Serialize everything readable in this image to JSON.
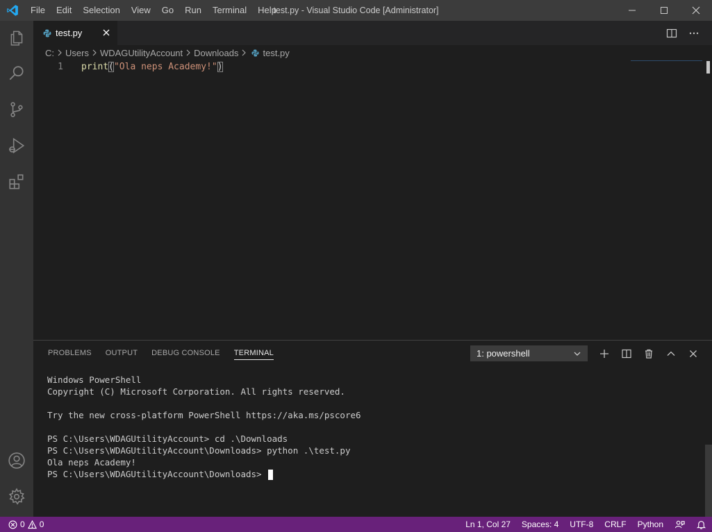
{
  "window": {
    "title": "test.py - Visual Studio Code [Administrator]"
  },
  "menu": [
    "File",
    "Edit",
    "Selection",
    "View",
    "Go",
    "Run",
    "Terminal",
    "Help"
  ],
  "tab": {
    "label": "test.py"
  },
  "breadcrumb": [
    "C:",
    "Users",
    "WDAGUtilityAccount",
    "Downloads",
    "test.py"
  ],
  "editor": {
    "line_number": "1",
    "code": {
      "fn": "print",
      "open": "(",
      "string": "\"Ola neps Academy!\"",
      "close": ")"
    }
  },
  "panel": {
    "tabs": [
      "PROBLEMS",
      "OUTPUT",
      "DEBUG CONSOLE",
      "TERMINAL"
    ],
    "active_tab": "TERMINAL",
    "terminal_select": "1: powershell"
  },
  "terminal": {
    "lines": [
      "Windows PowerShell",
      "Copyright (C) Microsoft Corporation. All rights reserved.",
      "",
      "Try the new cross-platform PowerShell https://aka.ms/pscore6",
      "",
      "PS C:\\Users\\WDAGUtilityAccount> cd .\\Downloads",
      "PS C:\\Users\\WDAGUtilityAccount\\Downloads> python .\\test.py",
      "Ola neps Academy!",
      "PS C:\\Users\\WDAGUtilityAccount\\Downloads> "
    ]
  },
  "status": {
    "errors": "0",
    "warnings": "0",
    "position": "Ln 1, Col 27",
    "spaces": "Spaces: 4",
    "encoding": "UTF-8",
    "eol": "CRLF",
    "language": "Python"
  },
  "colors": {
    "statusbar": "#68217a",
    "titlebar": "#3c3c3c",
    "activitybar": "#333333",
    "editor_bg": "#1e1e1e",
    "accent": "#007acc"
  },
  "icons": {
    "activity": [
      "explorer-icon",
      "search-icon",
      "source-control-icon",
      "run-debug-icon",
      "extensions-icon",
      "account-icon",
      "manage-gear-icon"
    ],
    "panel_actions": [
      "new-terminal-icon",
      "split-terminal-icon",
      "kill-terminal-icon",
      "maximize-panel-icon",
      "close-panel-icon"
    ]
  }
}
